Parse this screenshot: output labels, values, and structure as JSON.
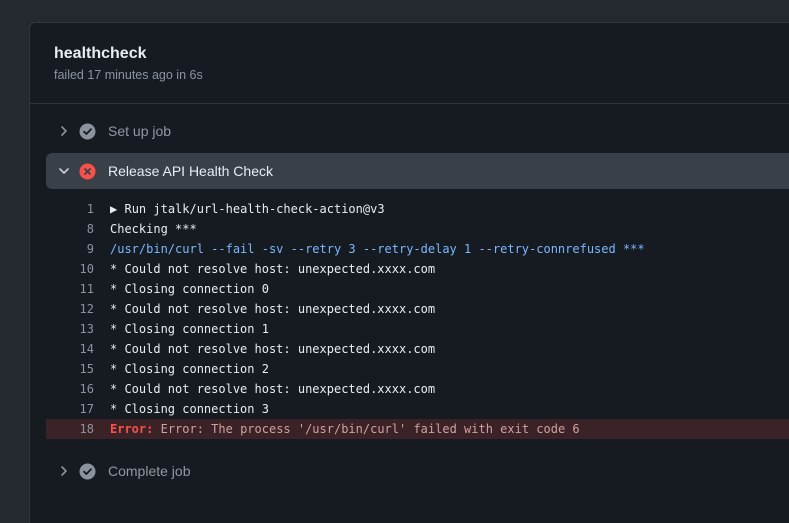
{
  "job": {
    "title": "healthcheck",
    "subtitle": "failed 17 minutes ago in 6s"
  },
  "steps": [
    {
      "label": "Set up job",
      "status": "success",
      "expanded": false
    },
    {
      "label": "Release API Health Check",
      "status": "failure",
      "expanded": true
    },
    {
      "label": "Complete job",
      "status": "success",
      "expanded": false
    }
  ],
  "log": {
    "lines": [
      {
        "num": "1",
        "text": "Run jtalk/url-health-check-action@v3",
        "expander": "▶"
      },
      {
        "num": "8",
        "text": "Checking ***"
      },
      {
        "num": "9",
        "text": "/usr/bin/curl --fail -sv --retry 3 --retry-delay 1 --retry-connrefused ***"
      },
      {
        "num": "10",
        "text": "* Could not resolve host: unexpected.xxxx.com"
      },
      {
        "num": "11",
        "text": "* Closing connection 0"
      },
      {
        "num": "12",
        "text": "* Could not resolve host: unexpected.xxxx.com"
      },
      {
        "num": "13",
        "text": "* Closing connection 1"
      },
      {
        "num": "14",
        "text": "* Could not resolve host: unexpected.xxxx.com"
      },
      {
        "num": "15",
        "text": "* Closing connection 2"
      },
      {
        "num": "16",
        "text": "* Could not resolve host: unexpected.xxxx.com"
      },
      {
        "num": "17",
        "text": "* Closing connection 3"
      },
      {
        "num": "18",
        "prefix": "Error:",
        "text": "Error: The process '/usr/bin/curl' failed with exit code 6"
      }
    ]
  },
  "colors": {
    "success": "#8b949e",
    "failure": "#f85149",
    "command": "#79b8ff"
  }
}
